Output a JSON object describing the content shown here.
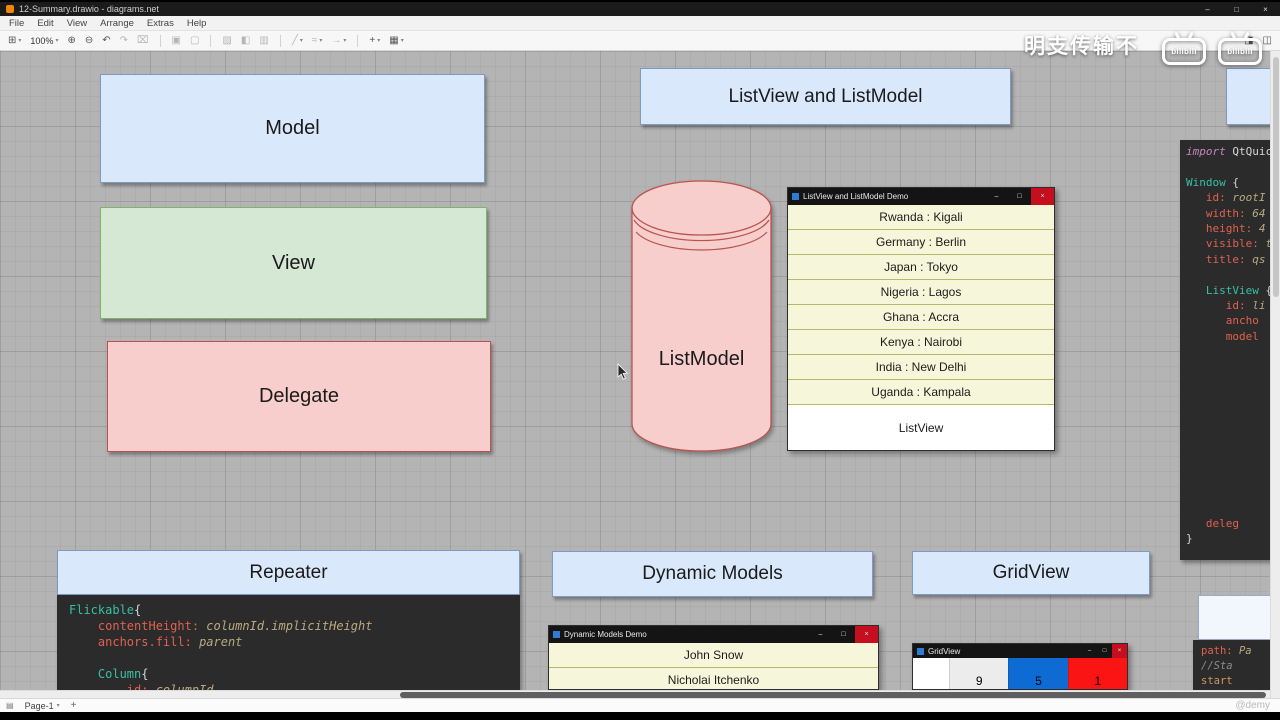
{
  "window": {
    "title": "12-Summary.drawio - diagrams.net"
  },
  "win_controls": {
    "minimize": "–",
    "maximize": "□",
    "close": "×"
  },
  "ui": {
    "caret": "▾"
  },
  "menu": {
    "items": [
      "File",
      "Edit",
      "View",
      "Arrange",
      "Extras",
      "Help"
    ]
  },
  "toolbar": {
    "zoom": "100%",
    "icons": [
      {
        "name": "view-grid-icon",
        "glyph": "⊞",
        "caret": true
      },
      {
        "name": "zoom-level",
        "glyph": "100%",
        "caret": true,
        "text": true
      },
      {
        "name": "zoom-in-icon",
        "glyph": "⊕"
      },
      {
        "name": "zoom-out-icon",
        "glyph": "⊖"
      },
      {
        "name": "undo-icon",
        "glyph": "↶"
      },
      {
        "name": "redo-icon",
        "glyph": "↷",
        "dim": true
      },
      {
        "name": "delete-icon",
        "glyph": "⌧",
        "dim": true
      },
      {
        "name": "divider"
      },
      {
        "name": "to-front-icon",
        "glyph": "▣",
        "dim": true
      },
      {
        "name": "to-back-icon",
        "glyph": "▢",
        "dim": true
      },
      {
        "name": "divider"
      },
      {
        "name": "fill-color-icon",
        "glyph": "▨",
        "dim": true
      },
      {
        "name": "line-color-icon",
        "glyph": "◧",
        "dim": true
      },
      {
        "name": "shadow-icon",
        "glyph": "▥",
        "dim": true
      },
      {
        "name": "divider"
      },
      {
        "name": "connection-style-icon",
        "glyph": "╱",
        "caret": true,
        "dim": true
      },
      {
        "name": "waypoints-icon",
        "glyph": "≈",
        "caret": true,
        "dim": true
      },
      {
        "name": "arrow-style-icon",
        "glyph": "→",
        "caret": true,
        "dim": true
      },
      {
        "name": "divider"
      },
      {
        "name": "insert-icon",
        "glyph": "+",
        "caret": true
      },
      {
        "name": "table-icon",
        "glyph": "▦",
        "caret": true
      }
    ],
    "right_icons": [
      {
        "name": "format-panel-icon",
        "glyph": "◨"
      },
      {
        "name": "outline-panel-icon",
        "glyph": "◫"
      }
    ]
  },
  "watermark": {
    "text": "明支传输不",
    "brand": "bilibili"
  },
  "canvas": {
    "boxes": {
      "model": "Model",
      "view": "View",
      "delegate": "Delegate",
      "header": "ListView and ListModel",
      "repeater": "Repeater",
      "dynamic_models": "Dynamic Models",
      "gridview": "GridView"
    },
    "cylinder_label": "ListModel"
  },
  "demo_window": {
    "title": "ListView and ListModel Demo",
    "rows": [
      "Rwanda : Kigali",
      "Germany : Berlin",
      "Japan : Tokyo",
      "Nigeria : Lagos",
      "Ghana : Accra",
      "Kenya : Nairobi",
      "India : New Delhi",
      "Uganda : Kampala"
    ],
    "footer": "ListView"
  },
  "dynamic_window": {
    "title": "Dynamic Models Demo",
    "rows": [
      "John Snow",
      "Nicholai Itchenko"
    ]
  },
  "grid_window": {
    "title": "GridView",
    "cells": [
      {
        "v": "",
        "bg": "#ffffff"
      },
      {
        "v": "9",
        "bg": "#ececec"
      },
      {
        "v": "5",
        "bg": "#0e6bd3"
      },
      {
        "v": "1",
        "bg": "#fb1414"
      }
    ]
  },
  "code_right": {
    "lines": [
      [
        {
          "t": "import ",
          "c": "kw"
        },
        {
          "t": "QtQuic",
          "c": "pl"
        }
      ],
      [],
      [
        {
          "t": "Window",
          "c": "ty"
        },
        {
          "t": " {",
          "c": "pl"
        }
      ],
      [
        {
          "t": "   ",
          "c": "pl"
        },
        {
          "t": "id: ",
          "c": "pr"
        },
        {
          "t": "rootI",
          "c": "va"
        }
      ],
      [
        {
          "t": "   ",
          "c": "pl"
        },
        {
          "t": "width: ",
          "c": "pr"
        },
        {
          "t": "64",
          "c": "nu"
        }
      ],
      [
        {
          "t": "   ",
          "c": "pl"
        },
        {
          "t": "height: ",
          "c": "pr"
        },
        {
          "t": "4",
          "c": "nu"
        }
      ],
      [
        {
          "t": "   ",
          "c": "pl"
        },
        {
          "t": "visible: ",
          "c": "pr"
        },
        {
          "t": "t",
          "c": "va"
        }
      ],
      [
        {
          "t": "   ",
          "c": "pl"
        },
        {
          "t": "title: ",
          "c": "pr"
        },
        {
          "t": "qs",
          "c": "va"
        }
      ],
      [],
      [
        {
          "t": "   ",
          "c": "pl"
        },
        {
          "t": "ListView",
          "c": "ty"
        },
        {
          "t": " {",
          "c": "pl"
        }
      ],
      [
        {
          "t": "      ",
          "c": "pl"
        },
        {
          "t": "id: ",
          "c": "pr"
        },
        {
          "t": "li",
          "c": "va"
        }
      ],
      [
        {
          "t": "      ",
          "c": "pl"
        },
        {
          "t": "ancho",
          "c": "pr"
        }
      ],
      [
        {
          "t": "      ",
          "c": "pl"
        },
        {
          "t": "model",
          "c": "pr"
        }
      ],
      {
        "gap": 172
      },
      [
        {
          "t": "   ",
          "c": "pl"
        },
        {
          "t": "deleg",
          "c": "pr"
        }
      ],
      [
        {
          "t": "}",
          "c": "pl"
        }
      ]
    ]
  },
  "code_repeater": {
    "lines": [
      [
        {
          "t": "Flickable",
          "c": "ty"
        },
        {
          "t": "{",
          "c": "pl"
        }
      ],
      [
        {
          "t": "    ",
          "c": "pl"
        },
        {
          "t": "contentHeight: ",
          "c": "pr"
        },
        {
          "t": "columnId.implicitHeight",
          "c": "va"
        }
      ],
      [
        {
          "t": "    ",
          "c": "pl"
        },
        {
          "t": "anchors.fill: ",
          "c": "pr"
        },
        {
          "t": "parent",
          "c": "va"
        }
      ],
      [],
      [
        {
          "t": "    ",
          "c": "pl"
        },
        {
          "t": "Column",
          "c": "ty"
        },
        {
          "t": "{",
          "c": "pl"
        }
      ],
      [
        {
          "t": "        ",
          "c": "pl"
        },
        {
          "t": "id: ",
          "c": "pr"
        },
        {
          "t": "columnId",
          "c": "va"
        }
      ]
    ]
  },
  "code_br": {
    "lines": [
      [
        {
          "t": "path: ",
          "c": "pr"
        },
        {
          "t": "Pa",
          "c": "va"
        }
      ],
      [
        {
          "t": "//Sta",
          "c": "cm"
        }
      ],
      [
        {
          "t": "start",
          "c": "st"
        }
      ]
    ]
  },
  "statusbar": {
    "pages_glyph": "▤",
    "page": "Page-1",
    "add": "+",
    "credit": "@demy"
  },
  "colors": {
    "canvas_bg": "#b4b4b4",
    "blue_fill": "#dae8fc",
    "green_fill": "#d5e8d4",
    "pink_fill": "#f8cecc",
    "code_bg": "#2b2b2b",
    "list_row_fill": "#f6f6da",
    "grid_blue": "#0e6bd3",
    "grid_red": "#fb1414",
    "close_red": "#c50f1f"
  }
}
